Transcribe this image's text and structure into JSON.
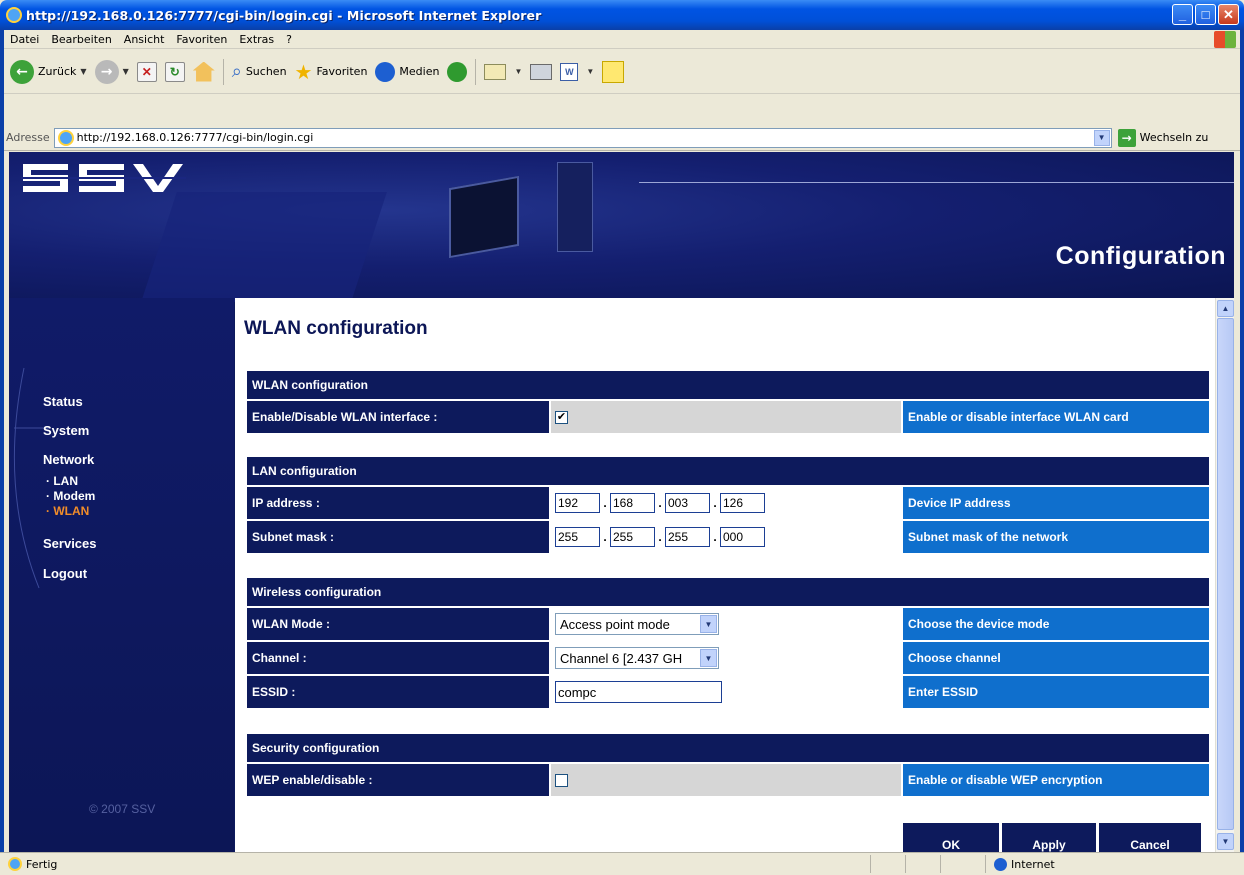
{
  "window": {
    "title": "http://192.168.0.126:7777/cgi-bin/login.cgi - Microsoft Internet Explorer",
    "min_label": "_",
    "max_label": "□",
    "close_label": "✕"
  },
  "menu": {
    "items": [
      "Datei",
      "Bearbeiten",
      "Ansicht",
      "Favoriten",
      "Extras",
      "?"
    ]
  },
  "toolbar": {
    "back_label": "Zurück",
    "search_label": "Suchen",
    "favorites_label": "Favoriten",
    "media_label": "Medien"
  },
  "address": {
    "label": "Adresse",
    "url": "http://192.168.0.126:7777/cgi-bin/login.cgi",
    "go_label": "Wechseln zu"
  },
  "banner": {
    "logo": "SSV",
    "title": "Configuration"
  },
  "nav": {
    "items": [
      "Status",
      "System",
      "Network",
      "Services",
      "Logout"
    ],
    "network_sub": [
      "· LAN",
      "· Modem",
      "· WLAN"
    ],
    "active": "· WLAN",
    "copyright": "© 2007 SSV"
  },
  "main": {
    "heading": "WLAN configuration",
    "wlan_section": {
      "title": "WLAN configuration",
      "enable_label": "Enable/Disable WLAN interface :",
      "enable_checked": true,
      "enable_desc": "Enable or disable interface WLAN card"
    },
    "lan_section": {
      "title": "LAN configuration",
      "ip_label": "IP address :",
      "ip": [
        "192",
        "168",
        "003",
        "126"
      ],
      "ip_desc": "Device IP address",
      "mask_label": "Subnet mask :",
      "mask": [
        "255",
        "255",
        "255",
        "000"
      ],
      "mask_desc": "Subnet mask of the network"
    },
    "wireless_section": {
      "title": "Wireless configuration",
      "mode_label": "WLAN Mode :",
      "mode_value": "Access point mode",
      "mode_desc": "Choose the device mode",
      "channel_label": "Channel :",
      "channel_value": "Channel 6 [2.437 GH",
      "channel_desc": "Choose channel",
      "essid_label": "ESSID :",
      "essid_value": "compc",
      "essid_desc": "Enter ESSID"
    },
    "security_section": {
      "title": "Security configuration",
      "wep_label": "WEP enable/disable :",
      "wep_checked": false,
      "wep_desc": "Enable or disable WEP encryption"
    },
    "buttons": {
      "ok": "OK",
      "apply": "Apply",
      "cancel": "Cancel"
    }
  },
  "status": {
    "text": "Fertig",
    "zone": "Internet"
  }
}
